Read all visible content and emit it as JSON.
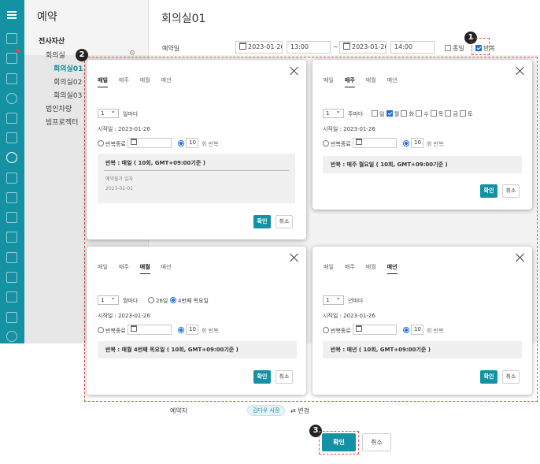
{
  "colors": {
    "accent": "#1591a4",
    "callout": "#222222",
    "highlight_border": "#e0524a",
    "check": "#1e6fd9"
  },
  "rail": {
    "icons": [
      "menu-icon",
      "home-icon",
      "mail-icon",
      "calendar-icon",
      "person-icon",
      "folder-icon",
      "grid-icon",
      "clock-icon",
      "edit-icon",
      "board-icon",
      "briefcase-icon",
      "apps-icon",
      "document-icon",
      "list-icon",
      "bullets-icon",
      "chat-icon",
      "settings-icon"
    ]
  },
  "tree": {
    "title": "예약",
    "group": "전사자산",
    "category": "회의실",
    "rooms": [
      "회의실01",
      "회의실02",
      "회의실03"
    ],
    "others": [
      "법인차량",
      "빔프로젝터"
    ]
  },
  "main": {
    "title": "회의실01",
    "date_label": "예약일",
    "start_date": "2023-01-26",
    "start_time": "13:00",
    "end_date": "2023-01-26",
    "end_time": "14:00",
    "allday_label": "종일",
    "repeat_label": "반복",
    "booker_label": "예약자",
    "booker_value": "김다우 사장",
    "change_label": "⇄ 변경",
    "ok": "확인",
    "cancel": "취소"
  },
  "callouts": [
    "1",
    "2",
    "3"
  ],
  "modals": {
    "tabs": [
      "매일",
      "매주",
      "매월",
      "매년"
    ],
    "daily": {
      "interval": "1",
      "unit": "일마다",
      "start": "시작일 : 2023-01-26",
      "end_label": "반복종료",
      "count": "10",
      "count_unit": "회 반복",
      "summary": "반복 : 매일 ( 10회, GMT+09:00기준 )",
      "unavailable_label": "예약불가 일자",
      "unavailable_date": "2023-02-01",
      "ok": "확인",
      "cancel": "취소"
    },
    "weekly": {
      "interval": "1",
      "unit": "주마다",
      "days": [
        "일",
        "월",
        "화",
        "수",
        "목",
        "금",
        "토"
      ],
      "checked_day": "월",
      "start": "시작일 : 2023-01-26",
      "end_label": "반복종료",
      "count": "10",
      "count_unit": "회 반복",
      "summary": "반복 : 매주 월요일 ( 10회, GMT+09:00기준 )",
      "ok": "확인",
      "cancel": "취소"
    },
    "monthly": {
      "interval": "1",
      "unit": "월마다",
      "option_day": "26일",
      "option_week": "4번째 목요일",
      "start": "시작일 : 2023-01-26",
      "end_label": "반복종료",
      "count": "10",
      "count_unit": "회 반복",
      "summary": "반복 : 매월 4번째 목요일 ( 10회, GMT+09:00기준 )",
      "ok": "확인",
      "cancel": "취소"
    },
    "yearly": {
      "interval": "1",
      "unit": "년마다",
      "start": "시작일 : 2023-01-26",
      "end_label": "반복종료",
      "count": "10",
      "count_unit": "회 반복",
      "summary": "반복 : 매년 ( 10회, GMT+09:00기준 )",
      "ok": "확인",
      "cancel": "취소"
    }
  }
}
